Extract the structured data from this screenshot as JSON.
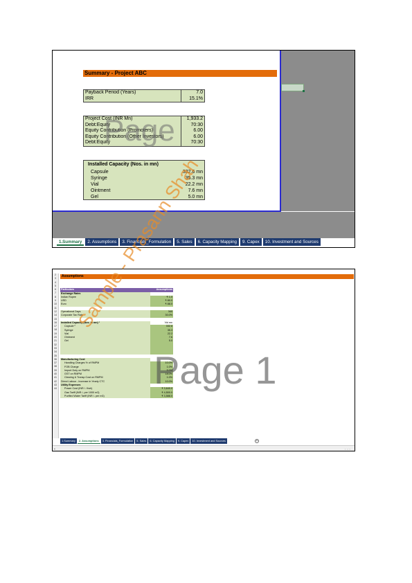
{
  "shot1": {
    "title": "Summary - Project ABC",
    "payback": [
      {
        "label": "Payback Period (Years)",
        "value": "7.0"
      },
      {
        "label": "IRR",
        "value": "15.1%"
      }
    ],
    "project": [
      {
        "label": "Project Cost (INR Mn)",
        "value": "1,933.2"
      },
      {
        "label": "Debt:Equity",
        "value": "70:30"
      },
      {
        "label": "Equity Contribution (Promoters)",
        "value": "6.00"
      },
      {
        "label": "Equity Contribution (Other Investors)",
        "value": "6.00"
      },
      {
        "label": "Debt:Equity",
        "value": "70:30"
      }
    ],
    "capacity": {
      "heading": "Installed Capacity (Nos. in mn)",
      "rows": [
        {
          "label": "Capsule",
          "value": "332.6 mn"
        },
        {
          "label": "Syringe",
          "value": "35.3 mn"
        },
        {
          "label": "Vial",
          "value": "22.2 mn"
        },
        {
          "label": "Ointment",
          "value": "7.6 mn"
        },
        {
          "label": "Gel",
          "value": "5.0 mn"
        }
      ]
    },
    "tabs": [
      "1.Summary",
      "2. Assumptions",
      "3. Financials_Formulation",
      "5. Sales",
      "6. Capacity Mapping",
      "9. Capex",
      "10. Investment and Sources"
    ],
    "active_tab": 0
  },
  "shot2": {
    "title": "Assumptions",
    "row_numbers": [
      "2",
      "3",
      "4",
      "5",
      "6",
      "7",
      "8",
      "9",
      "10",
      "11",
      "12",
      "14",
      "15",
      "16",
      "17",
      "18",
      "19",
      "20",
      "21",
      "32",
      "33",
      "34",
      "35",
      "36",
      "37",
      "38",
      "39",
      "40",
      "41",
      "42",
      "43",
      "44"
    ],
    "rows": [
      {
        "kind": "gap",
        "label": "",
        "value": ""
      },
      {
        "kind": "hdr",
        "label": "Particulars",
        "value": "Assumptions"
      },
      {
        "kind": "sec",
        "label": "Exchange Rates",
        "value": ""
      },
      {
        "kind": "dat",
        "label": "Indian Rupee",
        "value": "₹ 1.0"
      },
      {
        "kind": "dat",
        "label": "USD",
        "value": "₹ 80.0"
      },
      {
        "kind": "dat",
        "label": "Euro",
        "value": "₹ 88.0"
      },
      {
        "kind": "gap",
        "label": "",
        "value": ""
      },
      {
        "kind": "dat",
        "label": "Operational Days",
        "value": "340"
      },
      {
        "kind": "dat",
        "label": "Corporate Tax Rate",
        "value": "30.0%"
      },
      {
        "kind": "gap",
        "label": "",
        "value": ""
      },
      {
        "kind": "secw",
        "label": "Installed Capacity (Nos. in mn) ¹",
        "value": "Vid mn"
      },
      {
        "kind": "ind",
        "label": "Capsule ²",
        "value": "332.6"
      },
      {
        "kind": "ind",
        "label": "Syringe",
        "value": "35.3"
      },
      {
        "kind": "ind",
        "label": "Vial",
        "value": "22.2"
      },
      {
        "kind": "ind",
        "label": "Ointment",
        "value": "7.6"
      },
      {
        "kind": "ind",
        "label": "Gel",
        "value": "5.0"
      },
      {
        "kind": "blank",
        "label": "",
        "value": ""
      },
      {
        "kind": "blank",
        "label": "",
        "value": ""
      },
      {
        "kind": "blank",
        "label": "",
        "value": ""
      },
      {
        "kind": "gap",
        "label": "",
        "value": ""
      },
      {
        "kind": "sec",
        "label": "Manufacturing Cost",
        "value": ""
      },
      {
        "kind": "ind",
        "label": "Handling Charges % of RMPM",
        "value": "10.0%"
      },
      {
        "kind": "ind",
        "label": "FOB Charge",
        "value": "1.0%"
      },
      {
        "kind": "ind",
        "label": "Import Duty on RMPM",
        "value": "5.0%"
      },
      {
        "kind": "ind",
        "label": "GST on RMPM",
        "value": "18.0%"
      },
      {
        "kind": "ind",
        "label": "Clearing & Transp Cost on RMPM",
        "value": "1.0%"
      },
      {
        "kind": "dat",
        "label": "Direct Labour - Increase in Yearly CTC",
        "value": "10.0%"
      },
      {
        "kind": "sec",
        "label": "Utility Expenses",
        "value": ""
      },
      {
        "kind": "ind",
        "label": "Power Cost (INR /- Kwh)",
        "value": "₹ 3,640.0"
      },
      {
        "kind": "ind",
        "label": "Gas Tariff (INR /- per 1000 m3)",
        "value": "₹ 4,500.0"
      },
      {
        "kind": "ind",
        "label": "Purified Water Tariff (INR /- per m3)",
        "value": "₹ 3,588.0"
      }
    ],
    "tabs": [
      "1.Summary",
      "2. Assumptions",
      "3. Financials_Formulation",
      "5. Sales",
      "6. Capacity Mapping",
      "9. Capex",
      "10. Investment and Sources"
    ],
    "active_tab": 1,
    "add_sheet": "+"
  },
  "watermarks": {
    "page_top": "Page",
    "page_bottom": "Page 1",
    "diagonal": "Sample - Prasann Shah"
  },
  "colors": {
    "title_bar": "#e36c0a",
    "input_fill": "#d7e4bd",
    "value_fill": "#a9c57f",
    "header_purple": "#7b5ea7",
    "tab_navy": "#1f3b6f",
    "sheet_border_blue": "#2a2ad0"
  }
}
